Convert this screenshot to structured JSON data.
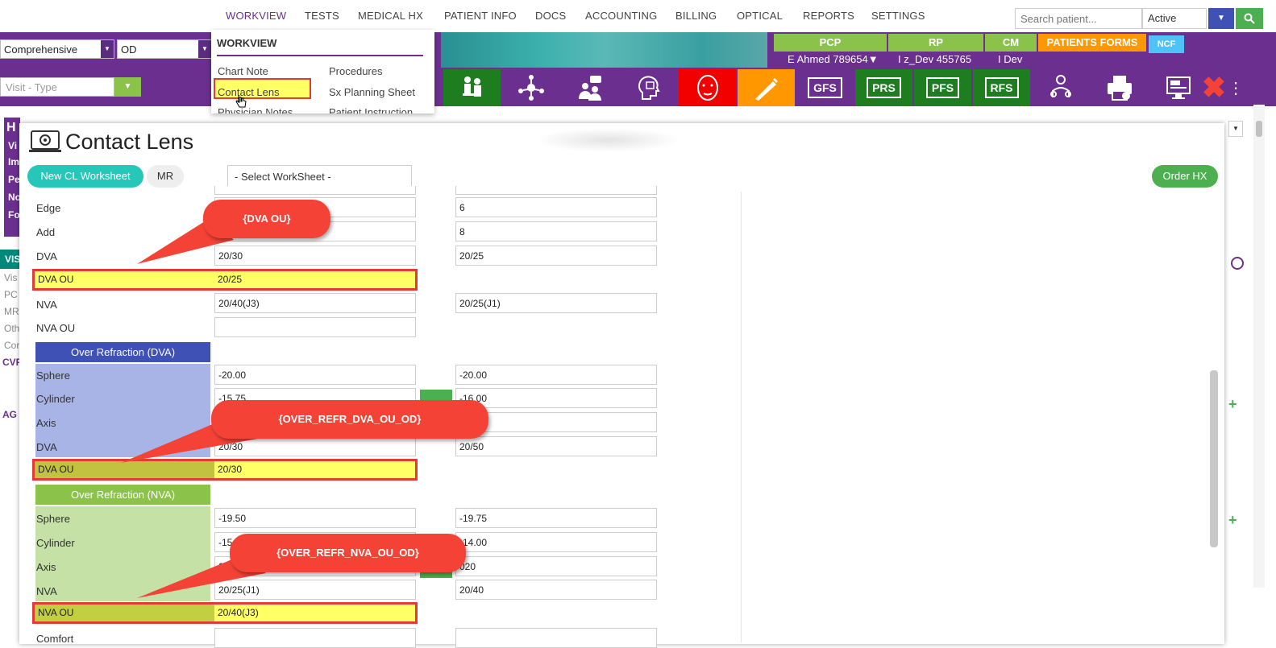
{
  "nav": {
    "items": [
      "WORKVIEW",
      "TESTS",
      "MEDICAL HX",
      "PATIENT INFO",
      "DOCS",
      "ACCOUNTING",
      "BILLING",
      "OPTICAL",
      "REPORTS",
      "SETTINGS"
    ],
    "search_placeholder": "Search patient...",
    "status_value": "Active"
  },
  "bar2": {
    "exam_type": "Comprehensive",
    "eye": "OD",
    "providers": [
      {
        "label": "PCP",
        "value": "E Ahmed 789654▼"
      },
      {
        "label": "RP",
        "value": "I z_Dev 455765"
      },
      {
        "label": "CM",
        "value": "I Dev"
      }
    ],
    "patients_forms": "PATIENTS FORMS",
    "ncf": "NCF"
  },
  "bar3": {
    "visit_type_placeholder": "Visit - Type",
    "tools": [
      "GFS",
      "PRS",
      "PFS",
      "RFS"
    ]
  },
  "dropdown": {
    "title": "WORKVIEW",
    "left_items": [
      "Chart Note",
      "Contact Lens",
      "Physician Notes"
    ],
    "right_items": [
      "Procedures",
      "Sx Planning Sheet",
      "Patient Instruction"
    ]
  },
  "sidebar": {
    "letters": [
      "H",
      "Vi",
      "Im",
      "Pe",
      "No",
      "Fo"
    ],
    "vis_label": "VIS",
    "items": [
      "Vis",
      "PC",
      "MR",
      "Oth",
      "Cor"
    ],
    "cvf": "CVF",
    "ag": "AG"
  },
  "modal": {
    "title": "Contact Lens",
    "new_worksheet": "New CL Worksheet",
    "mr": "MR",
    "select_worksheet": "- Select WorkSheet -",
    "order_hx": "Order HX"
  },
  "form": {
    "rows_top": [
      {
        "label": "Edge",
        "od": "",
        "os": "6"
      },
      {
        "label": "Add",
        "od": "",
        "os": "8"
      },
      {
        "label": "DVA",
        "od": "20/30",
        "os": "20/25"
      },
      {
        "label": "DVA OU",
        "od": "20/25",
        "os": ""
      },
      {
        "label": "NVA",
        "od": "20/40(J3)",
        "os": "20/25(J1)"
      },
      {
        "label": "NVA OU",
        "od": "",
        "os": ""
      }
    ],
    "over_dva_header": "Over Refraction (DVA)",
    "over_dva_rows": [
      {
        "label": "Sphere",
        "od": "-20.00",
        "os": "-20.00"
      },
      {
        "label": "Cylinder",
        "od": "-15.75",
        "os": "-16.00"
      },
      {
        "label": "Axis",
        "od": "",
        "os": ""
      },
      {
        "label": "DVA",
        "od": "20/30",
        "os": "20/50"
      },
      {
        "label": "DVA OU",
        "od": "20/30",
        "os": ""
      }
    ],
    "over_nva_header": "Over Refraction (NVA)",
    "over_nva_rows": [
      {
        "label": "Sphere",
        "od": "-19.50",
        "os": "-19.75"
      },
      {
        "label": "Cylinder",
        "od": "-15",
        "os": "-14.00"
      },
      {
        "label": "Axis",
        "od": "010",
        "os": "020"
      },
      {
        "label": "NVA",
        "od": "20/25(J1)",
        "os": "20/40"
      },
      {
        "label": "NVA OU",
        "od": "20/40(J3)",
        "os": ""
      },
      {
        "label": "Comfort",
        "od": "",
        "os": ""
      }
    ]
  },
  "callouts": {
    "dva_ou": "{DVA OU}",
    "over_dva": "{OVER_REFR_DVA_OU_OD}",
    "over_nva": "{OVER_REFR_NVA_OU_OD}"
  },
  "colors": {
    "purple": "#6b2f8f",
    "green_dark": "#1e7d1e",
    "callout_red": "#f44336",
    "highlight_yellow": "#ffff66",
    "dva_shade": "#a9b4e6",
    "nva_shade": "#c5e1a5"
  }
}
